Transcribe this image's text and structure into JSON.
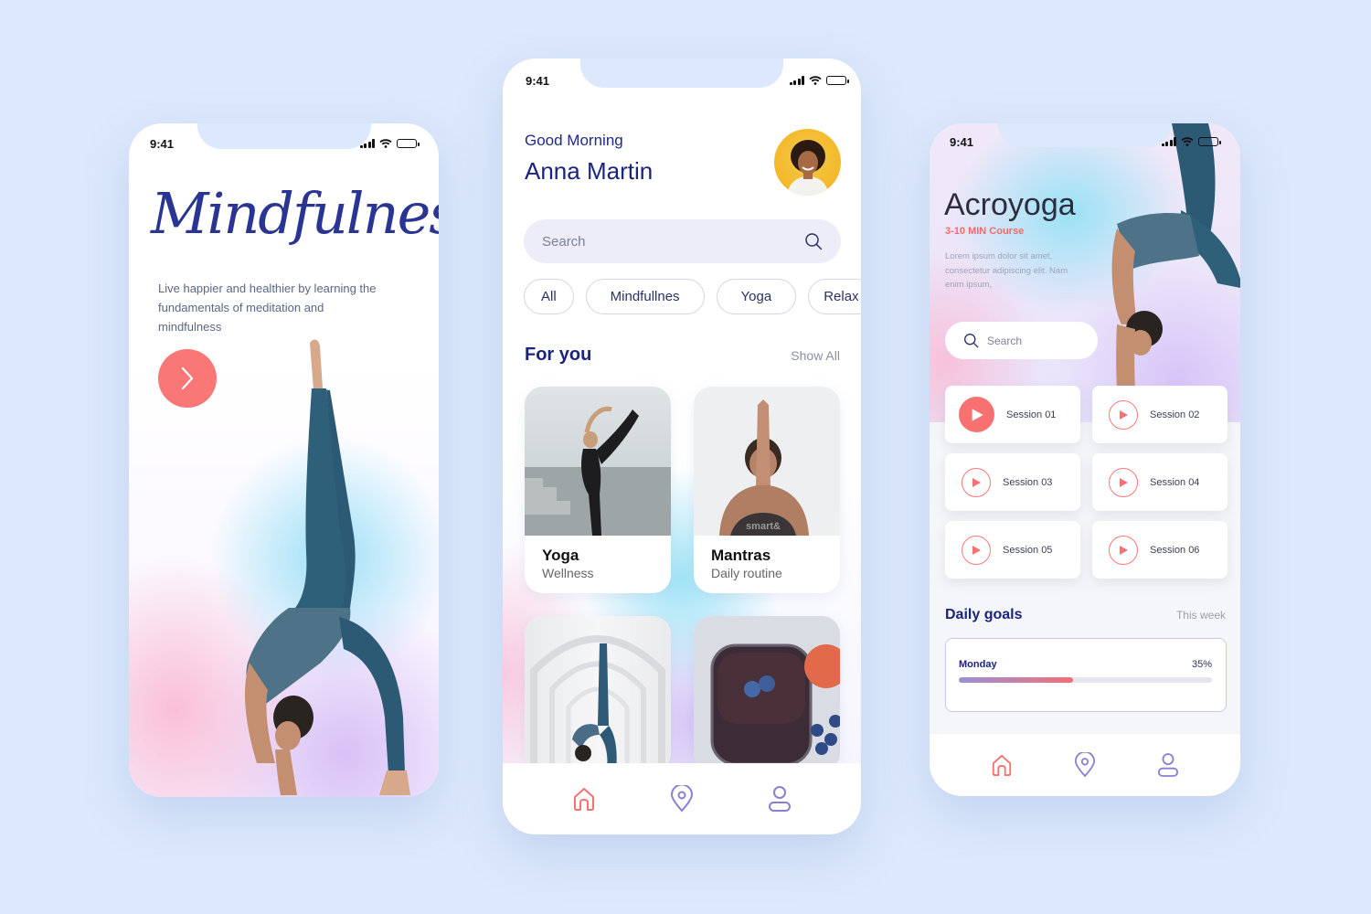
{
  "status": {
    "time": "9:41"
  },
  "onboarding": {
    "title": "Mindfulness",
    "description": "Live happier and healthier by learning the fundamentals of meditation and mindfulness",
    "next_icon": "chevron-right-icon"
  },
  "home": {
    "greeting": "Good Morning",
    "user_name": "Anna Martin",
    "search_placeholder": "Search",
    "chips": [
      "All",
      "Mindfullnes",
      "Yoga",
      "Relax"
    ],
    "section_title": "For you",
    "show_all": "Show All",
    "cards": [
      {
        "title": "Yoga",
        "subtitle": "Wellness"
      },
      {
        "title": "Mantras",
        "subtitle": "Daily routine"
      },
      {
        "title": "",
        "subtitle": ""
      },
      {
        "title": "",
        "subtitle": ""
      }
    ],
    "nav": [
      "home-icon",
      "location-pin-icon",
      "profile-icon"
    ]
  },
  "course": {
    "title": "Acroyoga",
    "subtitle": "3-10 MIN Course",
    "description": "Lorem ipsum dolor sit amet, consectetur adipiscing elit. Nam enim ipsum,",
    "search_placeholder": "Search",
    "sessions": [
      "Session 01",
      "Session 02",
      "Session 03",
      "Session 04",
      "Session 05",
      "Session 06"
    ],
    "active_session": 0,
    "goals_title": "Daily goals",
    "goals_period": "This week",
    "goal": {
      "day": "Monday",
      "percent_label": "35%",
      "percent": 45
    }
  },
  "colors": {
    "accent": "#f87171",
    "navy": "#1a237e",
    "nav_inactive": "#8b7fd4",
    "background": "#dce8fb"
  }
}
